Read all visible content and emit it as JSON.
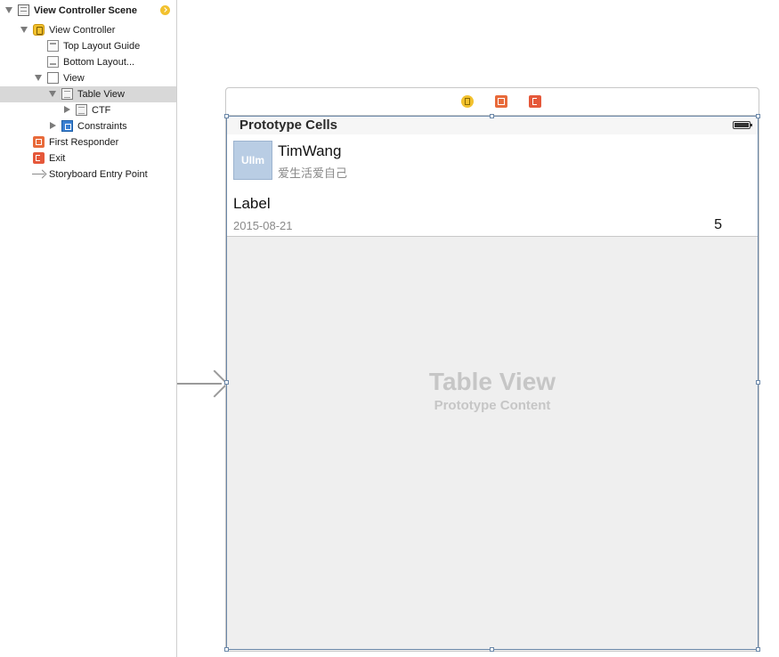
{
  "outline": {
    "items": [
      {
        "label": "View Controller Scene"
      },
      {
        "label": "View Controller"
      },
      {
        "label": "Top Layout Guide"
      },
      {
        "label": "Bottom Layout..."
      },
      {
        "label": "View"
      },
      {
        "label": "Table View"
      },
      {
        "label": "CTF"
      },
      {
        "label": "Constraints"
      },
      {
        "label": "First Responder"
      },
      {
        "label": "Exit"
      },
      {
        "label": "Storyboard Entry Point"
      }
    ]
  },
  "canvas": {
    "prototype_cells_title": "Prototype Cells",
    "cell1": {
      "avatar_text": "UIIm",
      "name": "TimWang",
      "subtitle": "爱生活爱自己"
    },
    "cell2": {
      "label": "Label",
      "date": "2015-08-21",
      "count": "5"
    },
    "placeholder": {
      "title": "Table View",
      "subtitle": "Prototype Content"
    }
  },
  "colors": {
    "selection": "#d8d8d8",
    "table_border": "#6a87a8",
    "avatar_bg": "#b9cde4",
    "vc_icon": "#f2c12e",
    "responder_icon": "#e86a3a"
  }
}
